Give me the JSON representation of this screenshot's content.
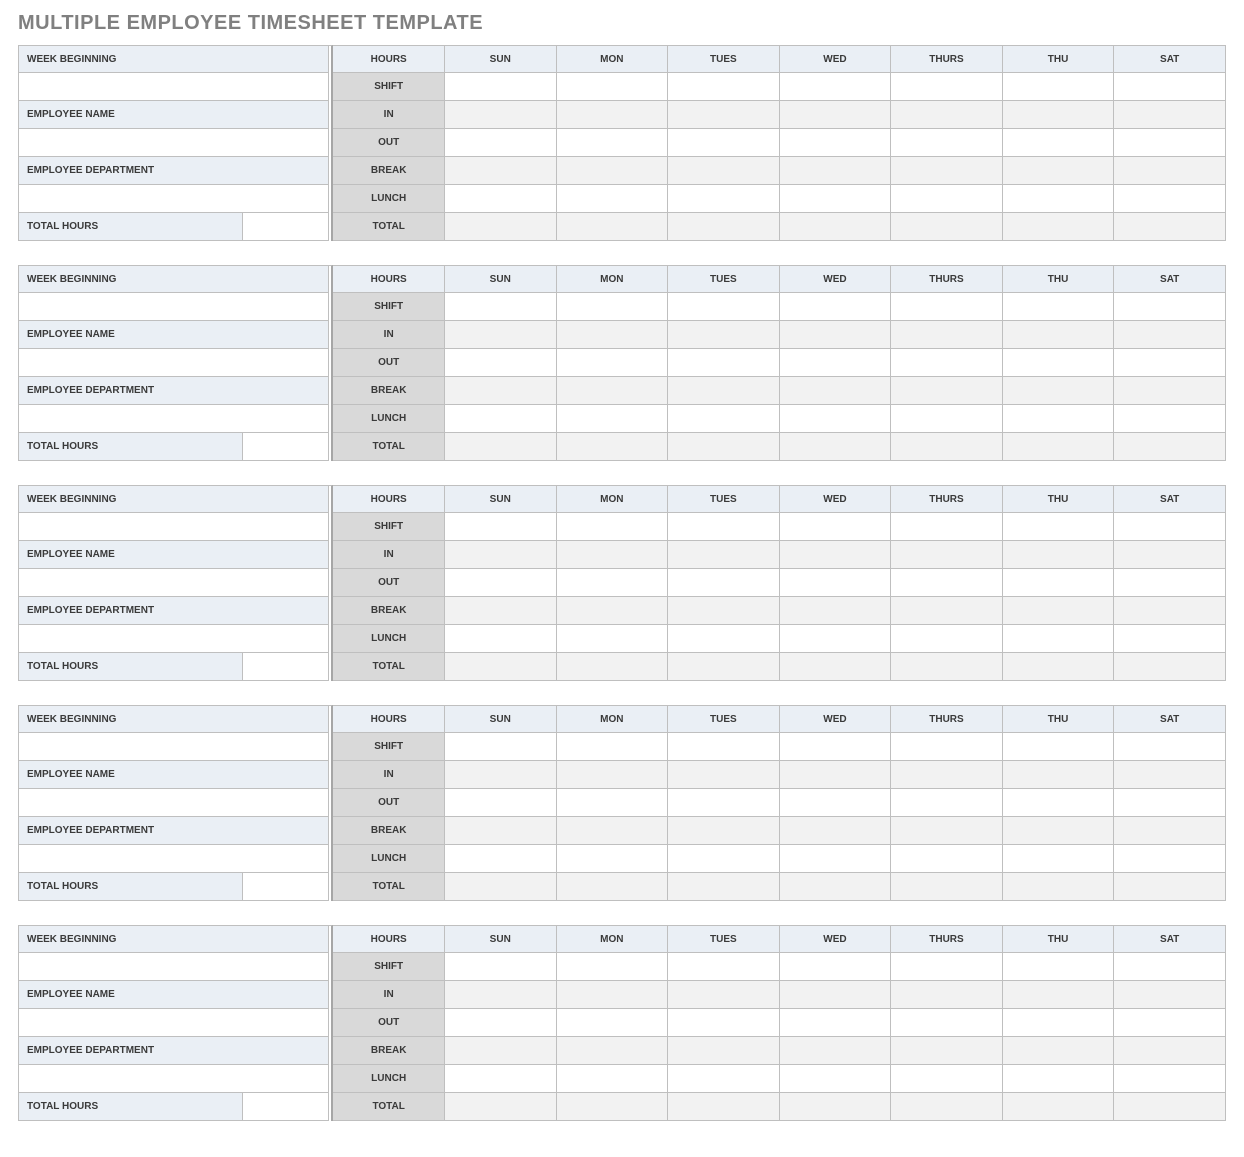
{
  "title": "MULTIPLE EMPLOYEE TIMESHEET TEMPLATE",
  "labels": {
    "week_beginning": "WEEK BEGINNING",
    "employee_name": "EMPLOYEE NAME",
    "employee_department": "EMPLOYEE DEPARTMENT",
    "total_hours": "TOTAL HOURS",
    "hours": "HOURS",
    "shift": "SHIFT",
    "in": "IN",
    "out": "OUT",
    "break": "BREAK",
    "lunch": "LUNCH",
    "total": "TOTAL"
  },
  "days": [
    "SUN",
    "MON",
    "TUES",
    "WED",
    "THURS",
    "THU",
    "SAT"
  ],
  "blocks": [
    {
      "week_beginning": "",
      "employee_name": "",
      "employee_department": "",
      "total_hours": "",
      "data": {
        "shift": [
          "",
          "",
          "",
          "",
          "",
          "",
          ""
        ],
        "in": [
          "",
          "",
          "",
          "",
          "",
          "",
          ""
        ],
        "out": [
          "",
          "",
          "",
          "",
          "",
          "",
          ""
        ],
        "break": [
          "",
          "",
          "",
          "",
          "",
          "",
          ""
        ],
        "lunch": [
          "",
          "",
          "",
          "",
          "",
          "",
          ""
        ],
        "total": [
          "",
          "",
          "",
          "",
          "",
          "",
          ""
        ]
      }
    },
    {
      "week_beginning": "",
      "employee_name": "",
      "employee_department": "",
      "total_hours": "",
      "data": {
        "shift": [
          "",
          "",
          "",
          "",
          "",
          "",
          ""
        ],
        "in": [
          "",
          "",
          "",
          "",
          "",
          "",
          ""
        ],
        "out": [
          "",
          "",
          "",
          "",
          "",
          "",
          ""
        ],
        "break": [
          "",
          "",
          "",
          "",
          "",
          "",
          ""
        ],
        "lunch": [
          "",
          "",
          "",
          "",
          "",
          "",
          ""
        ],
        "total": [
          "",
          "",
          "",
          "",
          "",
          "",
          ""
        ]
      }
    },
    {
      "week_beginning": "",
      "employee_name": "",
      "employee_department": "",
      "total_hours": "",
      "data": {
        "shift": [
          "",
          "",
          "",
          "",
          "",
          "",
          ""
        ],
        "in": [
          "",
          "",
          "",
          "",
          "",
          "",
          ""
        ],
        "out": [
          "",
          "",
          "",
          "",
          "",
          "",
          ""
        ],
        "break": [
          "",
          "",
          "",
          "",
          "",
          "",
          ""
        ],
        "lunch": [
          "",
          "",
          "",
          "",
          "",
          "",
          ""
        ],
        "total": [
          "",
          "",
          "",
          "",
          "",
          "",
          ""
        ]
      }
    },
    {
      "week_beginning": "",
      "employee_name": "",
      "employee_department": "",
      "total_hours": "",
      "data": {
        "shift": [
          "",
          "",
          "",
          "",
          "",
          "",
          ""
        ],
        "in": [
          "",
          "",
          "",
          "",
          "",
          "",
          ""
        ],
        "out": [
          "",
          "",
          "",
          "",
          "",
          "",
          ""
        ],
        "break": [
          "",
          "",
          "",
          "",
          "",
          "",
          ""
        ],
        "lunch": [
          "",
          "",
          "",
          "",
          "",
          "",
          ""
        ],
        "total": [
          "",
          "",
          "",
          "",
          "",
          "",
          ""
        ]
      }
    },
    {
      "week_beginning": "",
      "employee_name": "",
      "employee_department": "",
      "total_hours": "",
      "data": {
        "shift": [
          "",
          "",
          "",
          "",
          "",
          "",
          ""
        ],
        "in": [
          "",
          "",
          "",
          "",
          "",
          "",
          ""
        ],
        "out": [
          "",
          "",
          "",
          "",
          "",
          "",
          ""
        ],
        "break": [
          "",
          "",
          "",
          "",
          "",
          "",
          ""
        ],
        "lunch": [
          "",
          "",
          "",
          "",
          "",
          "",
          ""
        ],
        "total": [
          "",
          "",
          "",
          "",
          "",
          "",
          ""
        ]
      }
    }
  ]
}
